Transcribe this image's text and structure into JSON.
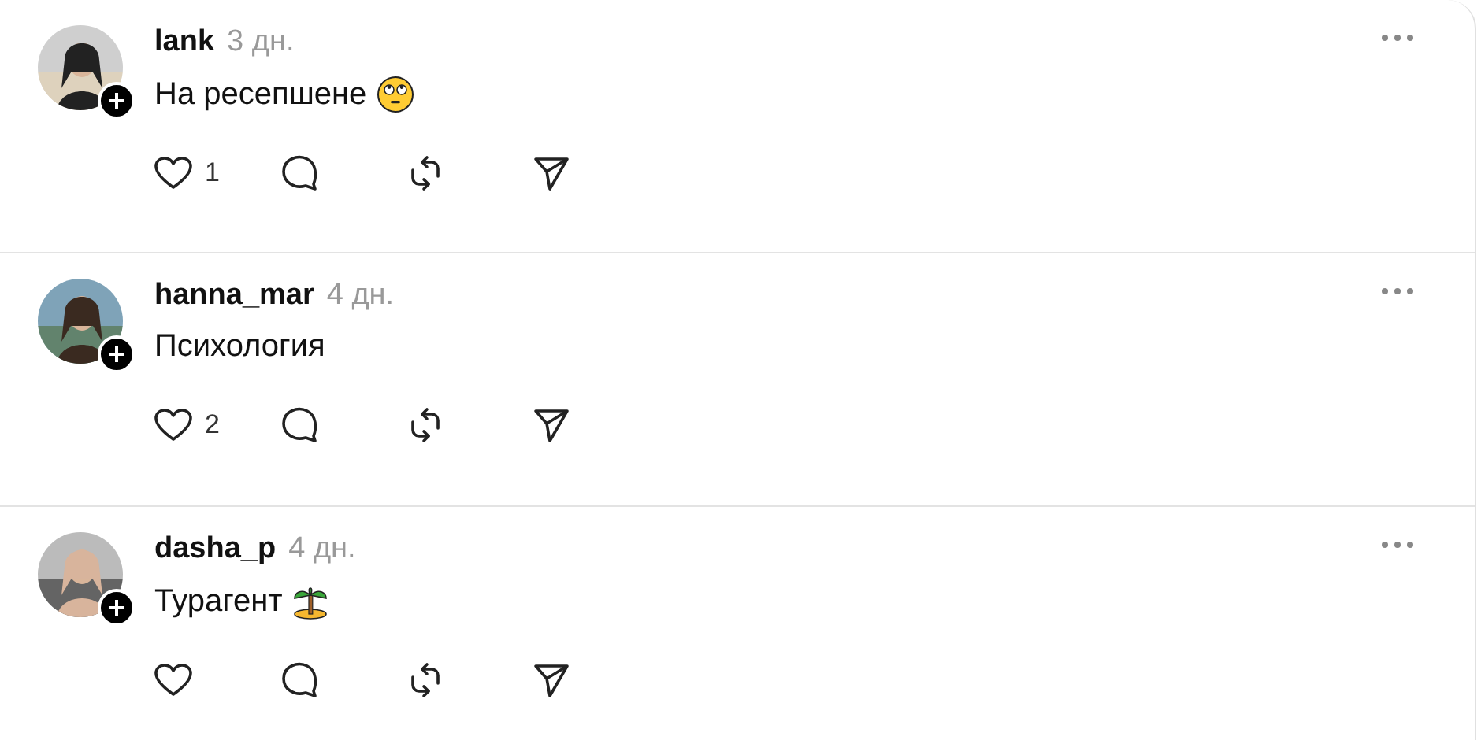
{
  "posts": [
    {
      "username": "lank",
      "time": "3 дн.",
      "text": "На ресепшене",
      "emoji": {
        "kind": "face"
      },
      "likes": "1"
    },
    {
      "username": "hanna_mar",
      "time": "4 дн.",
      "text": "Психология",
      "likes": "2"
    },
    {
      "username": "dasha_p",
      "time": "4 дн.",
      "text": "Турагент",
      "emoji": {
        "kind": "palm"
      }
    }
  ]
}
